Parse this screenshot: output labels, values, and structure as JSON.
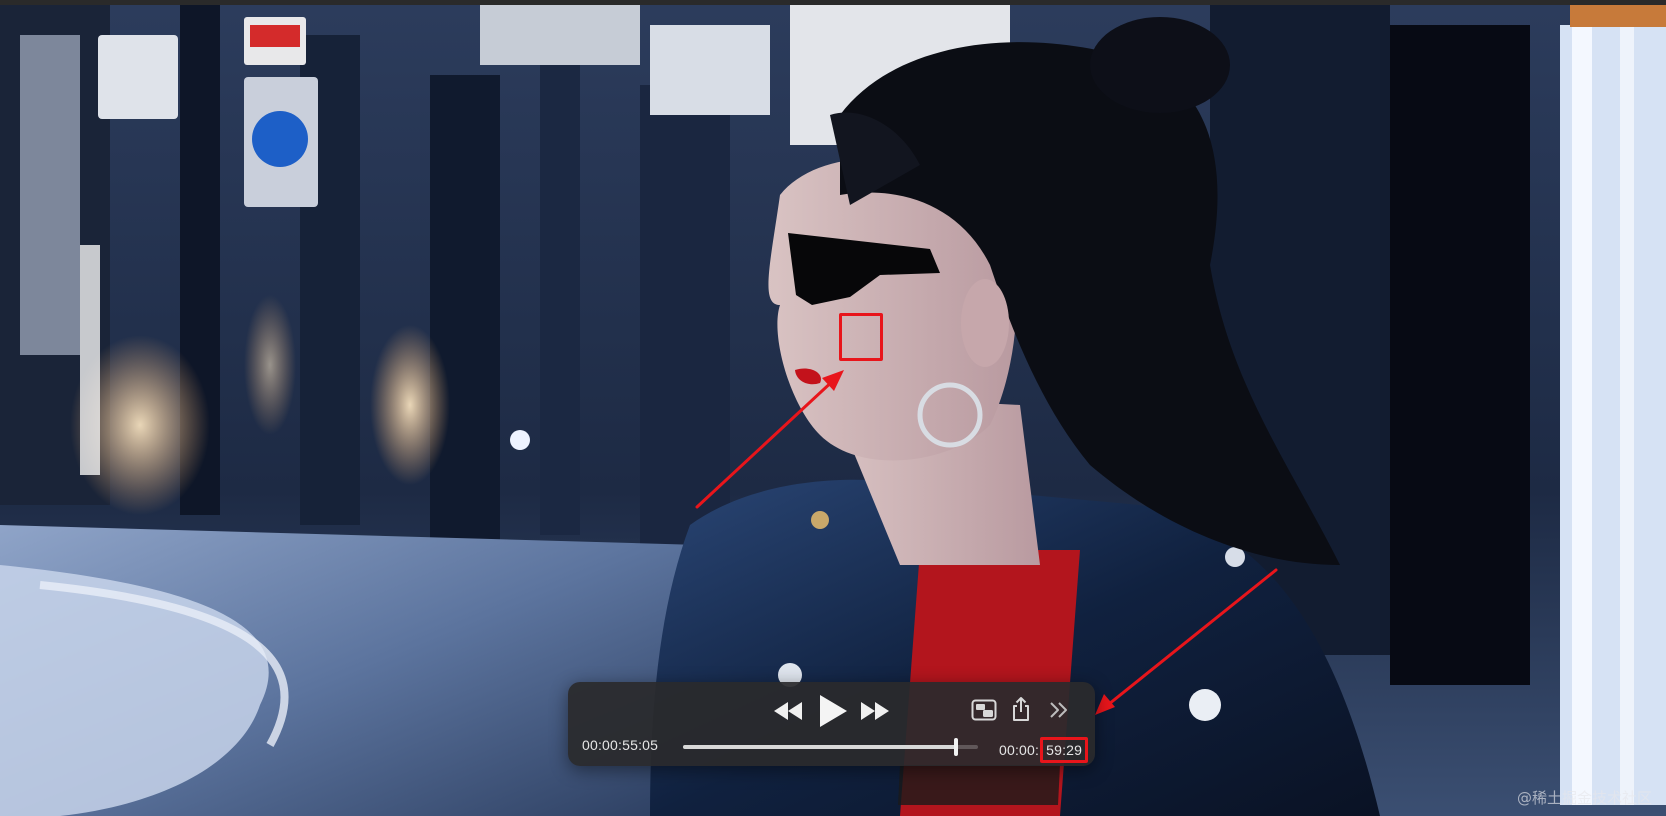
{
  "player": {
    "current_time": "00:00:55:05",
    "total_time_prefix": "00:00:",
    "total_time_highlight": "59:29",
    "progress": 0.9253,
    "controls": {
      "rewind_icon": "rewind-icon",
      "play_icon": "play-icon",
      "forward_icon": "fast-forward-icon",
      "pip_icon": "picture-in-picture-icon",
      "share_icon": "share-icon",
      "more_icon": "chevron-double-right-icon"
    }
  },
  "annotations": {
    "color": "#e8151b"
  },
  "watermark": "@稀土掘金技术社区"
}
